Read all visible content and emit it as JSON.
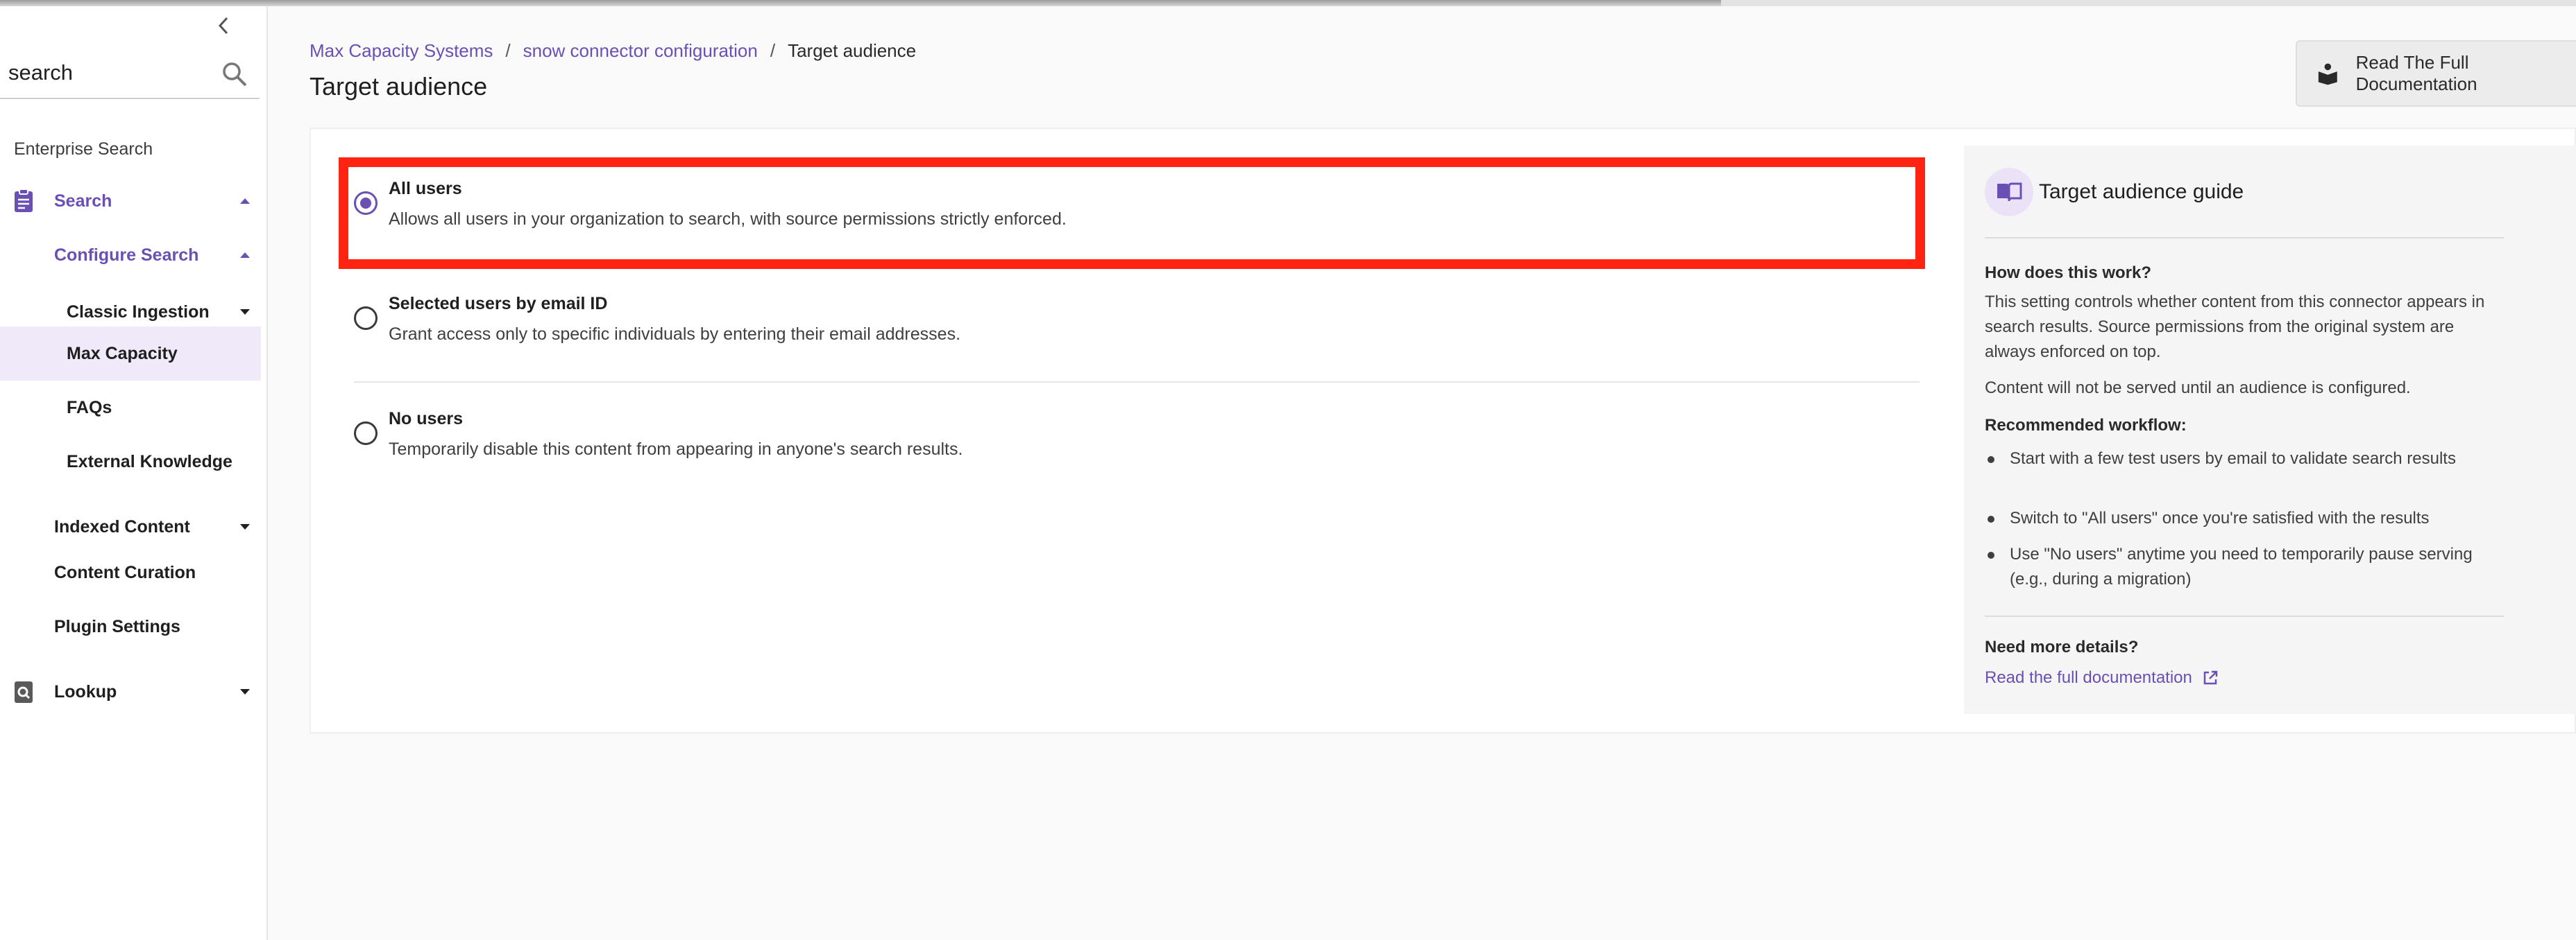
{
  "sidebar": {
    "search_value": "search",
    "section_label": "Enterprise Search",
    "items": [
      {
        "label": "Search",
        "icon": "clipboard-icon"
      },
      {
        "label": "Configure Search"
      },
      {
        "label": "Classic Ingestion"
      },
      {
        "label": "Max Capacity"
      },
      {
        "label": "FAQs"
      },
      {
        "label": "External Knowledge"
      },
      {
        "label": "Indexed Content"
      },
      {
        "label": "Content Curation"
      },
      {
        "label": "Plugin Settings"
      },
      {
        "label": "Lookup",
        "icon": "lookup-icon"
      }
    ]
  },
  "breadcrumb": {
    "items": [
      "Max Capacity Systems",
      "snow connector configuration",
      "Target audience"
    ],
    "separator": "/"
  },
  "page": {
    "title": "Target audience",
    "doc_button": "Read The Full Documentation"
  },
  "options": [
    {
      "title": "All users",
      "description": "Allows all users in your organization to search, with source permissions strictly enforced.",
      "selected": true
    },
    {
      "title": "Selected users by email ID",
      "description": "Grant access only to specific individuals by entering their email addresses.",
      "selected": false
    },
    {
      "title": "No users",
      "description": "Temporarily disable this content from appearing in anyone's search results.",
      "selected": false
    }
  ],
  "guide": {
    "title": "Target audience guide",
    "how_heading": "How does this work?",
    "how_text": "This setting controls whether content from this connector appears in search results. Source permissions from the original system are always enforced on top.",
    "note": "Content will not be served until an audience is configured.",
    "workflow_heading": "Recommended workflow:",
    "workflow": [
      "Start with a few test users by email to validate search results",
      "Switch to \"All users\" once you're satisfied with the results",
      "Use \"No users\" anytime you need to temporarily pause serving (e.g., during a migration)"
    ],
    "more_heading": "Need more details?",
    "link": "Read the full documentation"
  },
  "colors": {
    "accent": "#6a4fb5",
    "highlight": "#ff2412",
    "active_bg": "#f0e9fa"
  }
}
